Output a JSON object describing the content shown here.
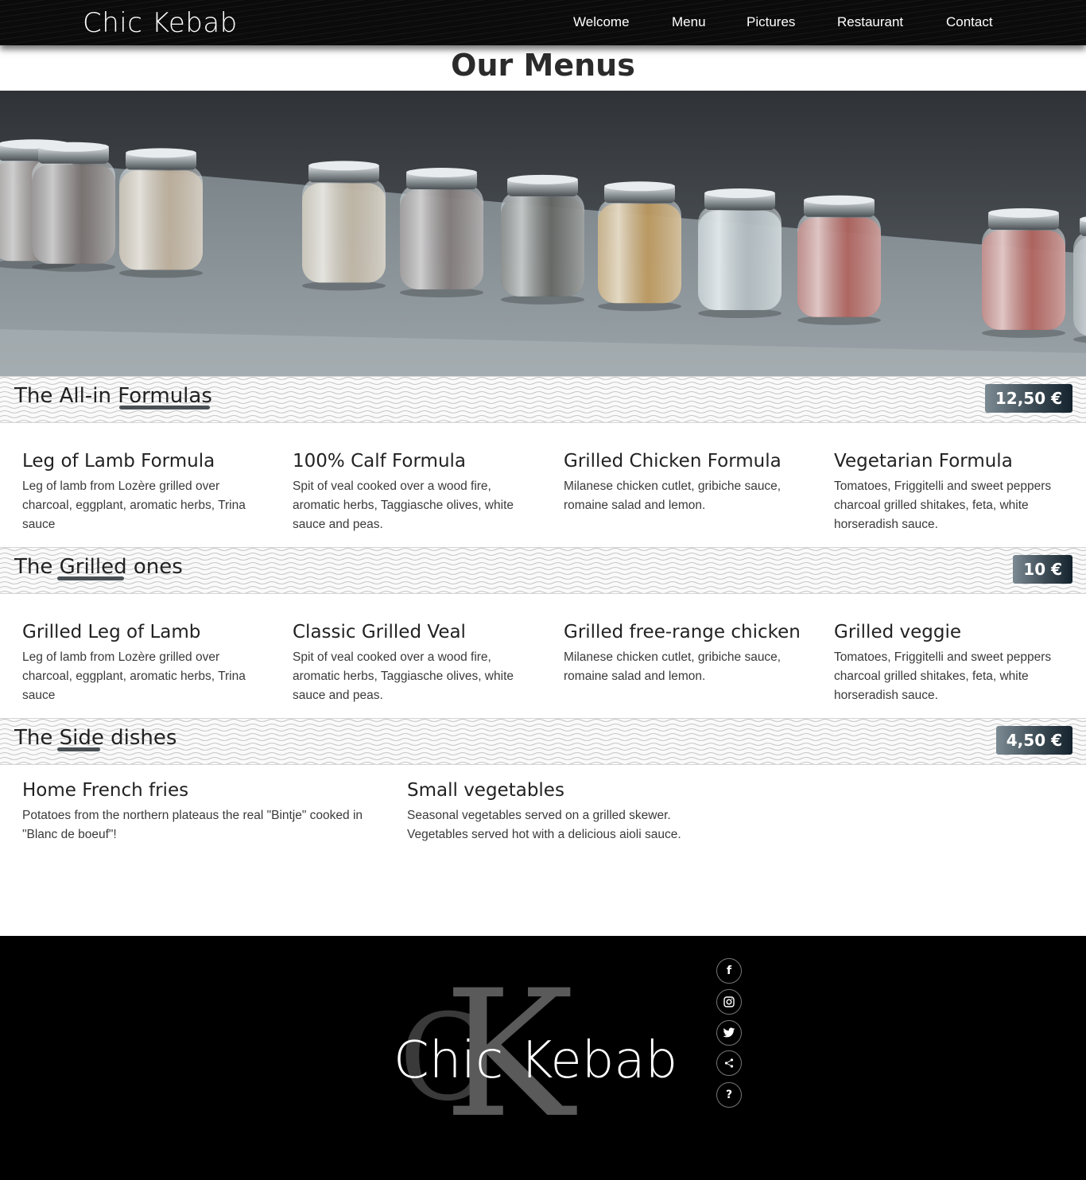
{
  "header": {
    "brand": "Chic Kebab",
    "nav": [
      "Welcome",
      "Menu",
      "Pictures",
      "Restaurant",
      "Contact"
    ]
  },
  "page": {
    "title": "Our Menus"
  },
  "sections": [
    {
      "title": "The All-in Formulas",
      "price": "12,50 €",
      "items": [
        {
          "name": "Leg of Lamb Formula",
          "desc": "Leg of lamb from Lozère grilled over charcoal, eggplant, aromatic herbs, Trina sauce"
        },
        {
          "name": "100% Calf Formula",
          "desc": "Spit of veal cooked over a wood fire, aromatic herbs, Taggiasche olives, white sauce and peas."
        },
        {
          "name": "Grilled Chicken Formula",
          "desc": "Milanese chicken cutlet, gribiche sauce, romaine salad and lemon."
        },
        {
          "name": "Vegetarian Formula",
          "desc": "Tomatoes, Friggitelli and sweet peppers charcoal grilled shitakes, feta, white horseradish sauce."
        }
      ]
    },
    {
      "title": "The Grilled ones",
      "price": "10 €",
      "items": [
        {
          "name": "Grilled Leg of Lamb",
          "desc": "Leg of lamb from Lozère grilled over charcoal, eggplant, aromatic herbs, Trina sauce"
        },
        {
          "name": "Classic Grilled Veal",
          "desc": "Spit of veal cooked over a wood fire, aromatic herbs, Taggiasche olives, white sauce and peas."
        },
        {
          "name": "Grilled free-range chicken",
          "desc": "Milanese chicken cutlet, gribiche sauce, romaine salad and lemon."
        },
        {
          "name": "Grilled veggie",
          "desc": "Tomatoes, Friggitelli and sweet peppers charcoal grilled shitakes, feta, white horseradish sauce."
        }
      ]
    },
    {
      "title": "The Side dishes",
      "price": "4,50 €",
      "items": [
        {
          "name": "Home French fries",
          "desc": "Potatoes from the northern plateaus the real \"Bintje\" cooked in \"Blanc de boeuf\"!"
        },
        {
          "name": "Small vegetables",
          "desc": "Seasonal vegetables served on a grilled skewer. Vegetables served hot with a delicious aioli sauce."
        }
      ]
    }
  ],
  "footer": {
    "logo_text": "Chic Kebab",
    "logo_monogram": [
      "C",
      "K"
    ],
    "social": [
      {
        "icon": "facebook-icon",
        "glyph": "f"
      },
      {
        "icon": "instagram-icon",
        "glyph": "◎"
      },
      {
        "icon": "twitter-icon",
        "glyph": "🐦"
      },
      {
        "icon": "share-icon",
        "glyph": "<"
      },
      {
        "icon": "help-icon",
        "glyph": "?"
      }
    ]
  },
  "colors": {
    "header_bg": "#0b0b0b",
    "footer_bg": "#000000",
    "badge_dark": "#14232d",
    "badge_light": "#7c8a93"
  }
}
